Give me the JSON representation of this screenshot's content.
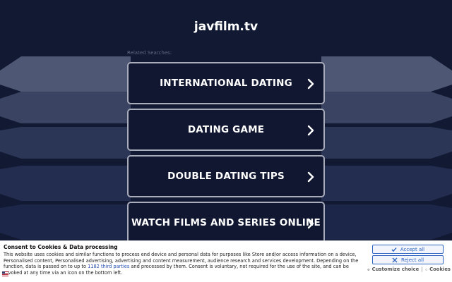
{
  "site": {
    "title": "javfilm.tv"
  },
  "related": {
    "label": "Related Searches:",
    "items": [
      {
        "label": "INTERNATIONAL DATING"
      },
      {
        "label": "DATING GAME"
      },
      {
        "label": "DOUBLE DATING TIPS"
      },
      {
        "label": "WATCH FILMS AND SERIES ONLINE"
      }
    ]
  },
  "consent": {
    "title": "Consent to Cookies & Data processing",
    "body_part1": "This website uses cookies and similar functions to process end device and personal data for purposes like Store and/or access information on a device, Personalised content, Personalised advertising, advertising and content measurement, audience research and services development. Depending on the function, data is passed on to up to ",
    "third_parties_link": "1182 third parties",
    "body_part2": " and processed by them. Consent is voluntary, not required for the use of the site, and can be revoked at any time via an icon on the bottom left.",
    "accept_label": "Accept all",
    "reject_label": "Reject all",
    "customize_label": "Customize choice",
    "separator": "|",
    "cookies_label": "Cookies"
  },
  "colors": {
    "background": "#121a33",
    "button_border": "#a9adbb",
    "consent_accent": "#2d64c2"
  },
  "icons": {
    "item_chevron": "chevron-right-icon",
    "accept": "check-icon",
    "reject": "x-icon",
    "customize": "gear-icon",
    "cookies": "diamond-icon",
    "privacy": "flag-icon"
  }
}
